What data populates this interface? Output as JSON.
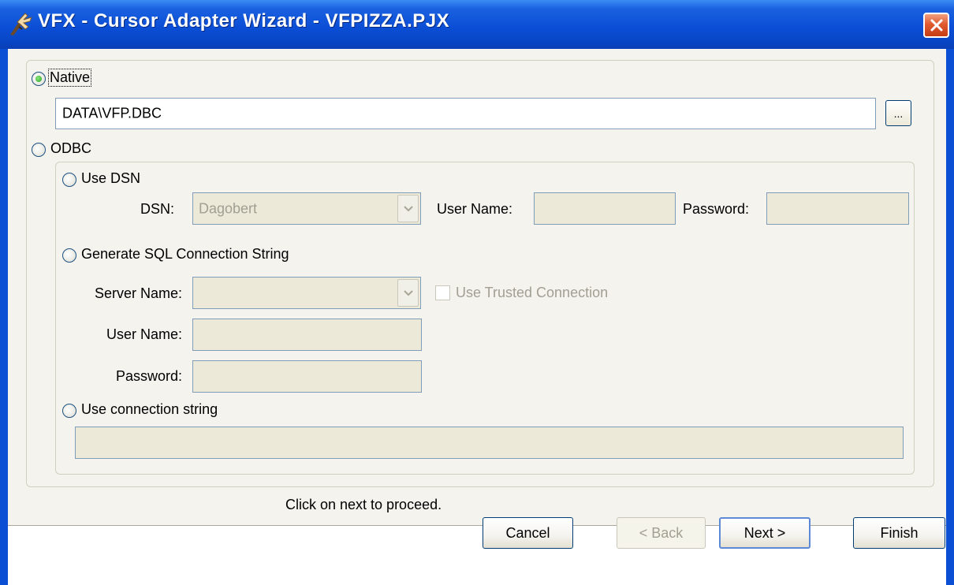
{
  "window": {
    "title": "VFX - Cursor Adapter Wizard - VFPIZZA.PJX"
  },
  "native": {
    "label": "Native",
    "selected": true,
    "value": "DATA\\VFP.DBC",
    "browse_label": "..."
  },
  "odbc": {
    "label": "ODBC",
    "use_dsn": {
      "label": "Use DSN",
      "dsn_label": "DSN:",
      "dsn_value": "Dagobert",
      "user_label": "User Name:",
      "user_value": "",
      "password_label": "Password:",
      "password_value": ""
    },
    "generate": {
      "label": "Generate SQL Connection String",
      "server_label": "Server Name:",
      "server_value": "",
      "trusted_label": "Use Trusted Connection",
      "user_label": "User Name:",
      "user_value": "",
      "password_label": "Password:",
      "password_value": ""
    },
    "conn_string": {
      "label": "Use connection string",
      "value": ""
    }
  },
  "status": "Click on next to proceed.",
  "buttons": {
    "cancel": "Cancel",
    "back": "< Back",
    "next": "Next >",
    "finish": "Finish"
  },
  "colors": {
    "titlebar": "#0b4fd6",
    "panel": "#f4f3ee",
    "disabled_field": "#ece9d8",
    "close": "#e05a30"
  }
}
